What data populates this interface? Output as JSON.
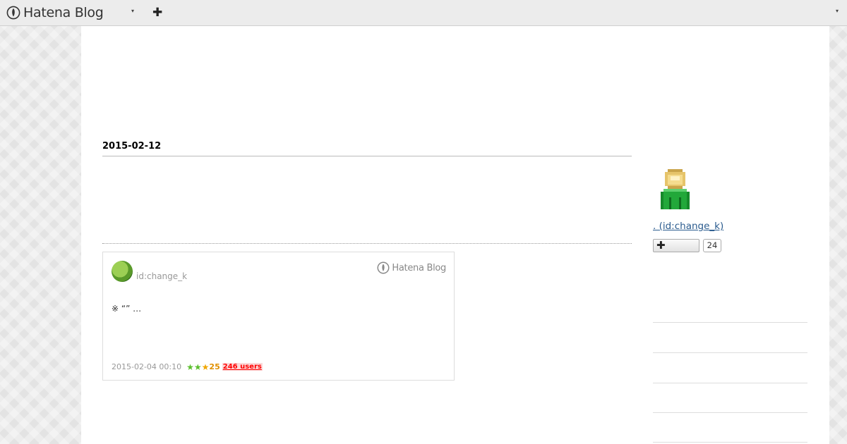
{
  "topbar": {
    "brand": "Hatena Blog",
    "menu_caret_icon": "caret-down-icon",
    "add_icon": "plus-icon"
  },
  "main": {
    "date_heading": "2015-02-12"
  },
  "embed_card": {
    "user_id": "id:change_k",
    "brand": "Hatena Blog",
    "excerpt": "※ “” …",
    "date": "2015-02-04 00:10",
    "star_count": "25",
    "bookmark_users": "246 users"
  },
  "sidebar": {
    "profile_link": ". (id:change_k)",
    "follow_count": "24"
  },
  "colors": {
    "link": "#2a5b8e",
    "star_green": "#5cbf2e",
    "star_yellow": "#f0a700",
    "users_red": "#ff0000"
  }
}
